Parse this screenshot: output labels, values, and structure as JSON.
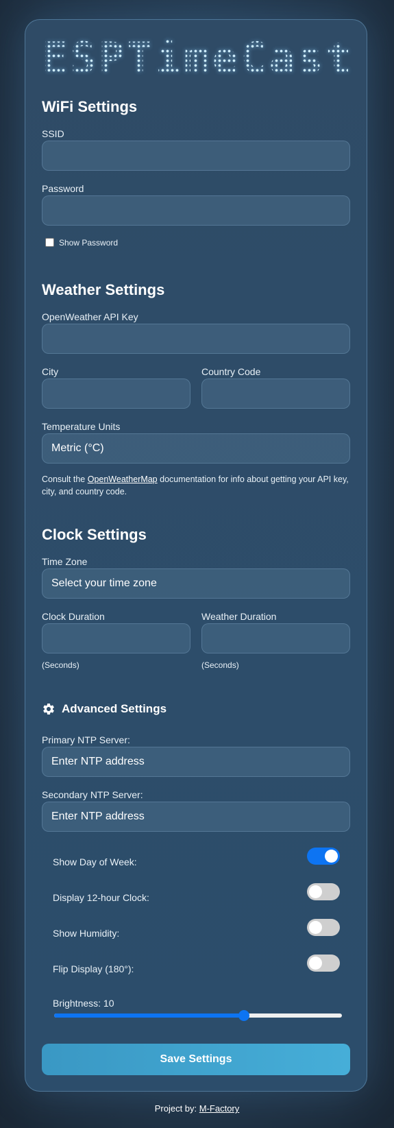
{
  "app": {
    "logo_text": "ESPTimeCast"
  },
  "wifi": {
    "heading": "WiFi Settings",
    "ssid_label": "SSID",
    "ssid_value": "",
    "password_label": "Password",
    "password_value": "",
    "show_password_label": "Show Password",
    "show_password_checked": false
  },
  "weather": {
    "heading": "Weather Settings",
    "api_key_label": "OpenWeather API Key",
    "api_key_value": "",
    "city_label": "City",
    "city_value": "",
    "country_label": "Country Code",
    "country_value": "",
    "units_label": "Temperature Units",
    "units_selected": "Metric (°C)",
    "note_prefix": "Consult the ",
    "note_link": "OpenWeatherMap",
    "note_suffix": " documentation for info about getting your API key, city, and country code."
  },
  "clock": {
    "heading": "Clock Settings",
    "timezone_label": "Time Zone",
    "timezone_selected": "Select your time zone",
    "clock_duration_label": "Clock Duration",
    "clock_duration_value": "",
    "clock_duration_hint": "(Seconds)",
    "weather_duration_label": "Weather Duration",
    "weather_duration_value": "",
    "weather_duration_hint": "(Seconds)"
  },
  "advanced": {
    "heading": "Advanced Settings",
    "icon": "gear-icon",
    "primary_ntp_label": "Primary NTP Server:",
    "primary_ntp_placeholder": "Enter NTP address",
    "secondary_ntp_label": "Secondary NTP Server:",
    "secondary_ntp_placeholder": "Enter NTP address",
    "toggles": [
      {
        "label": "Show Day of Week:",
        "on": true
      },
      {
        "label": "Display 12-hour Clock:",
        "on": false
      },
      {
        "label": "Show Humidity:",
        "on": false
      },
      {
        "label": "Flip Display (180°):",
        "on": false
      }
    ],
    "brightness_label": "Brightness: 10",
    "brightness_fraction": 0.66
  },
  "actions": {
    "save_label": "Save Settings"
  },
  "footer": {
    "prefix": "Project by: ",
    "link": "M-Factory"
  },
  "colors": {
    "accent_blue": "#0d74f2",
    "save_button": "#46aed8"
  }
}
